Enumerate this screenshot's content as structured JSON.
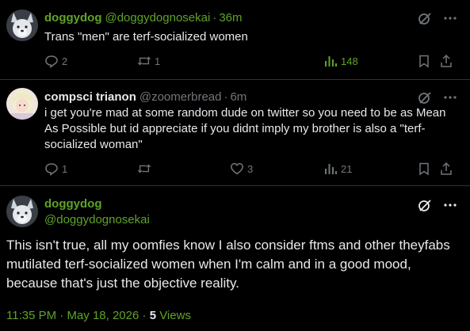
{
  "tweet1": {
    "display_name": "doggydog",
    "handle": "@doggydognosekai",
    "time": "36m",
    "text": "Trans \"men\" are terf-socialized women",
    "replies": "2",
    "reposts": "1",
    "likes": "",
    "views": "148"
  },
  "tweet2": {
    "display_name": "compsci trianon",
    "handle": "@zoomerbread",
    "time": "6m",
    "text": "i get you're mad at some random dude on twitter so you need to be as Mean As Possible but id appreciate if you didnt imply my brother is also a \"terf-socialized woman\"",
    "replies": "1",
    "reposts": "",
    "likes": "3",
    "views": "21"
  },
  "main": {
    "display_name": "doggydog",
    "handle": "@doggydognosekai",
    "text": "This isn't true, all my oomfies know I also consider ftms and other theyfabs mutilated terf-socialized women when I'm calm and in a good mood, because that's just the objective reality.",
    "time": "11:35 PM",
    "date": "May 18, 2026",
    "views_count": "5",
    "views_label": "Views"
  },
  "colors": {
    "accent_green": "#5fa32a",
    "muted": "#71767b",
    "background": "#000000"
  },
  "icons": [
    "grok-slash-icon",
    "more-icon",
    "reply-icon",
    "repost-icon",
    "like-icon",
    "views-icon",
    "bookmark-icon",
    "share-icon"
  ]
}
